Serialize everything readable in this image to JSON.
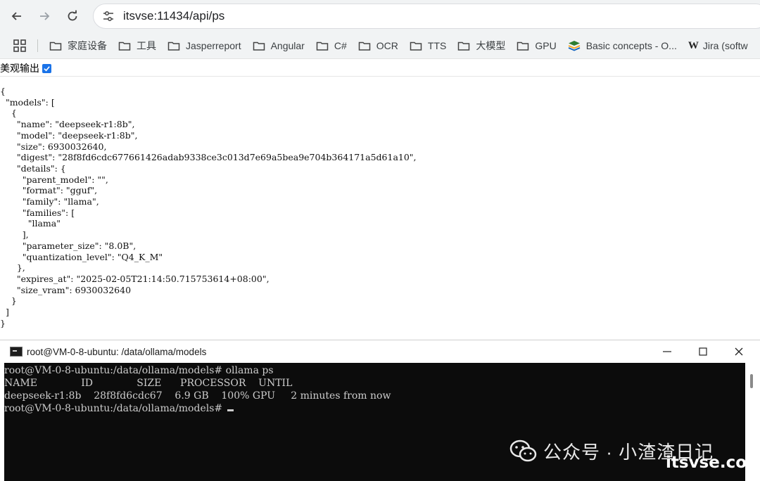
{
  "browser": {
    "url": "itsvse:11434/api/ps",
    "bookmarks": [
      {
        "label": "家庭设备",
        "icon": "folder-icon"
      },
      {
        "label": "工具",
        "icon": "folder-icon"
      },
      {
        "label": "Jasperreport",
        "icon": "folder-icon"
      },
      {
        "label": "Angular",
        "icon": "folder-icon"
      },
      {
        "label": "C#",
        "icon": "folder-icon"
      },
      {
        "label": "OCR",
        "icon": "folder-icon"
      },
      {
        "label": "TTS",
        "icon": "folder-icon"
      },
      {
        "label": "大模型",
        "icon": "folder-icon"
      },
      {
        "label": "GPU",
        "icon": "folder-icon"
      },
      {
        "label": "Basic concepts - O...",
        "icon": "layers-icon"
      },
      {
        "label": "Jira (softw",
        "icon": "wikipedia-w-icon",
        "icon_text": "W"
      }
    ]
  },
  "page": {
    "pretty_print_label": "美观输出",
    "pretty_print_checked": true,
    "json_text": "{\n  \"models\": [\n    {\n      \"name\": \"deepseek-r1:8b\",\n      \"model\": \"deepseek-r1:8b\",\n      \"size\": 6930032640,\n      \"digest\": \"28f8fd6cdc677661426adab9338ce3c013d7e69a5bea9e704b364171a5d61a10\",\n      \"details\": {\n        \"parent_model\": \"\",\n        \"format\": \"gguf\",\n        \"family\": \"llama\",\n        \"families\": [\n          \"llama\"\n        ],\n        \"parameter_size\": \"8.0B\",\n        \"quantization_level\": \"Q4_K_M\"\n      },\n      \"expires_at\": \"2025-02-05T21:14:50.715753614+08:00\",\n      \"size_vram\": 6930032640\n    }\n  ]\n}"
  },
  "terminal": {
    "title": "root@VM-0-8-ubuntu: /data/ollama/models",
    "lines": [
      "root@VM-0-8-ubuntu:/data/ollama/models# ollama ps",
      "NAME              ID              SIZE      PROCESSOR    UNTIL",
      "deepseek-r1:8b    28f8fd6cdc67    6.9 GB    100% GPU     2 minutes from now"
    ],
    "prompt": "root@VM-0-8-ubuntu:/data/ollama/models# "
  },
  "watermark": {
    "line1": "公众号 · 小渣渣日记",
    "line2": "itsvse.com"
  },
  "colors": {
    "chrome_bg": "#f1f3f4",
    "terminal_bg": "#0c0c0c",
    "terminal_fg": "#cccccc",
    "checkbox": "#1a73e8"
  }
}
